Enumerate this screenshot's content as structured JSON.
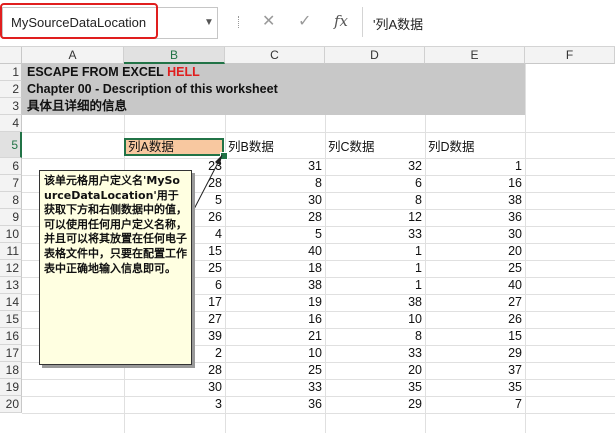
{
  "formula_bar": {
    "name_box": "MySourceDataLocation",
    "cancel_glyph": "✕",
    "enter_glyph": "✓",
    "fx_glyph": "fx",
    "dropdown_glyph": "▼",
    "formula": "'列A数据"
  },
  "sheet": {
    "columns": [
      "A",
      "B",
      "C",
      "D",
      "E",
      "F"
    ],
    "rows": [
      "1",
      "2",
      "3",
      "4",
      "5",
      "6",
      "7",
      "8",
      "9",
      "10",
      "11",
      "12",
      "13",
      "14",
      "15",
      "16",
      "17",
      "18",
      "19",
      "20"
    ],
    "title_part1": "ESCAPE FROM EXCEL ",
    "title_part2": "HELL",
    "chapter": "Chapter 00 - Description of this worksheet",
    "subtitle": "具体且详细的信息",
    "headers": [
      "列A数据",
      "列B数据",
      "列C数据",
      "列D数据"
    ],
    "data": [
      [
        23,
        31,
        32,
        1
      ],
      [
        28,
        8,
        6,
        16
      ],
      [
        5,
        30,
        8,
        38
      ],
      [
        26,
        28,
        12,
        36
      ],
      [
        4,
        5,
        33,
        30
      ],
      [
        15,
        40,
        1,
        20
      ],
      [
        25,
        18,
        1,
        25
      ],
      [
        6,
        38,
        1,
        40
      ],
      [
        17,
        19,
        38,
        27
      ],
      [
        27,
        16,
        10,
        26
      ],
      [
        39,
        21,
        8,
        15
      ],
      [
        2,
        10,
        33,
        29
      ],
      [
        28,
        25,
        20,
        37
      ],
      [
        30,
        33,
        35,
        35
      ],
      [
        3,
        36,
        29,
        7
      ]
    ],
    "comment": "该单元格用户定义名'MySourceDataLocation'用于获取下方和右侧数据中的值，可以使用任何用户定义名称，并且可以将其放置在任何电子表格文件中，只要在配置工作表中正确地输入信息即可。"
  },
  "colors": {
    "accent": "#217346",
    "highlight": "#e01e1e",
    "selected_fill": "#f8c8a0",
    "band": "#c8c8c8",
    "comment_bg": "#ffffe1"
  }
}
